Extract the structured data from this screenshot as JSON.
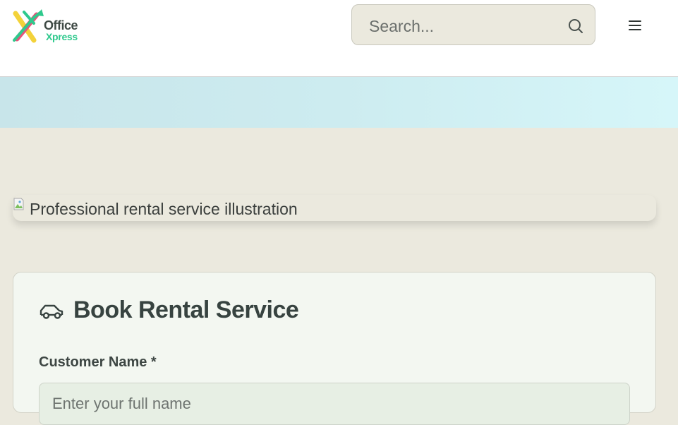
{
  "header": {
    "logo": {
      "word1": "Office",
      "word2": "Xpress",
      "letter": "X"
    },
    "search": {
      "placeholder": "Search..."
    },
    "menu_icon": "hamburger-menu-icon"
  },
  "main": {
    "image_alt": "Professional rental service illustration",
    "form": {
      "title": "Book Rental Service",
      "title_icon": "car-icon",
      "fields": [
        {
          "label": "Customer Name *",
          "placeholder": "Enter your full name",
          "value": ""
        }
      ]
    }
  },
  "colors": {
    "page_background": "#ebe9de",
    "logo_green": "#2fc98d",
    "logo_yellow": "#f3d23a",
    "logo_pink": "#e5537a",
    "hero_band": "#cdecf0",
    "card_background": "#f3f7f1"
  }
}
